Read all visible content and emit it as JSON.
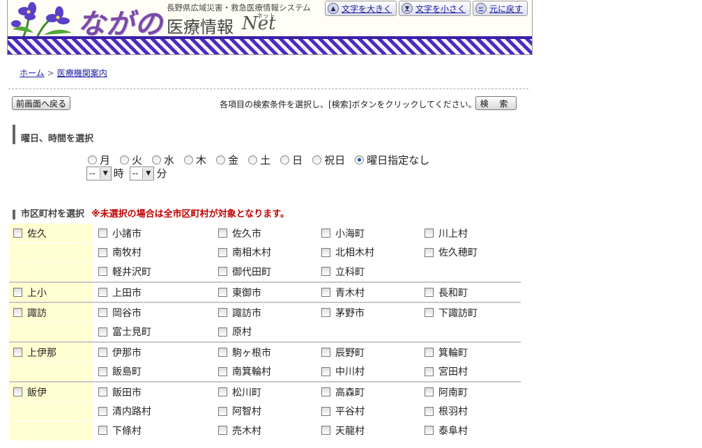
{
  "header": {
    "logo_main": "ながの",
    "logo_sub": "長野県広域災害・救急医療情報システム",
    "logo_title": "医療情報",
    "logo_net": "Net",
    "logo_net_ruby": "ネット",
    "buttons": [
      {
        "label": "文字を大きく",
        "icon": "arrow-up-icon"
      },
      {
        "label": "文字を小さく",
        "icon": "arrow-down-icon"
      },
      {
        "label": "元に戻す",
        "icon": "return-icon"
      }
    ],
    "colors": {
      "band": "#4a2cc0",
      "logo": "#7a4aa8"
    }
  },
  "breadcrumb": {
    "home": "ホーム",
    "sep": ">",
    "current": "医療機関案内"
  },
  "toolbar": {
    "back_label": "前画面へ戻る",
    "instruction": "各項目の検索条件を選択し、[検索]ボタンをクリックしてください。→",
    "search_label": "検 索"
  },
  "day_section": {
    "title": "曜日、時間を選択",
    "days": [
      "月",
      "火",
      "水",
      "木",
      "金",
      "土",
      "日",
      "祝日",
      "曜日指定なし"
    ],
    "selected": "曜日指定なし",
    "hour_value": "--",
    "hour_label": "時",
    "minute_value": "--",
    "minute_label": "分"
  },
  "city_section": {
    "title": "市区町村を選択",
    "note": "※未選択の場合は全市区町村が対象となります。"
  },
  "regions": [
    {
      "name": "佐久",
      "cities": [
        "小諸市",
        "佐久市",
        "小海町",
        "川上村",
        "南牧村",
        "南相木村",
        "北相木村",
        "佐久穂町",
        "軽井沢町",
        "御代田町",
        "立科町"
      ]
    },
    {
      "name": "上小",
      "cities": [
        "上田市",
        "東御市",
        "青木村",
        "長和町"
      ]
    },
    {
      "name": "諏訪",
      "cities": [
        "岡谷市",
        "諏訪市",
        "茅野市",
        "下諏訪町",
        "富士見町",
        "原村"
      ]
    },
    {
      "name": "上伊那",
      "cities": [
        "伊那市",
        "駒ヶ根市",
        "辰野町",
        "箕輪町",
        "飯島町",
        "南箕輪村",
        "中川村",
        "宮田村"
      ]
    },
    {
      "name": "飯伊",
      "cities": [
        "飯田市",
        "松川町",
        "高森町",
        "阿南町",
        "清内路村",
        "阿智村",
        "平谷村",
        "根羽村",
        "下條村",
        "売木村",
        "天龍村",
        "泰阜村"
      ]
    }
  ]
}
